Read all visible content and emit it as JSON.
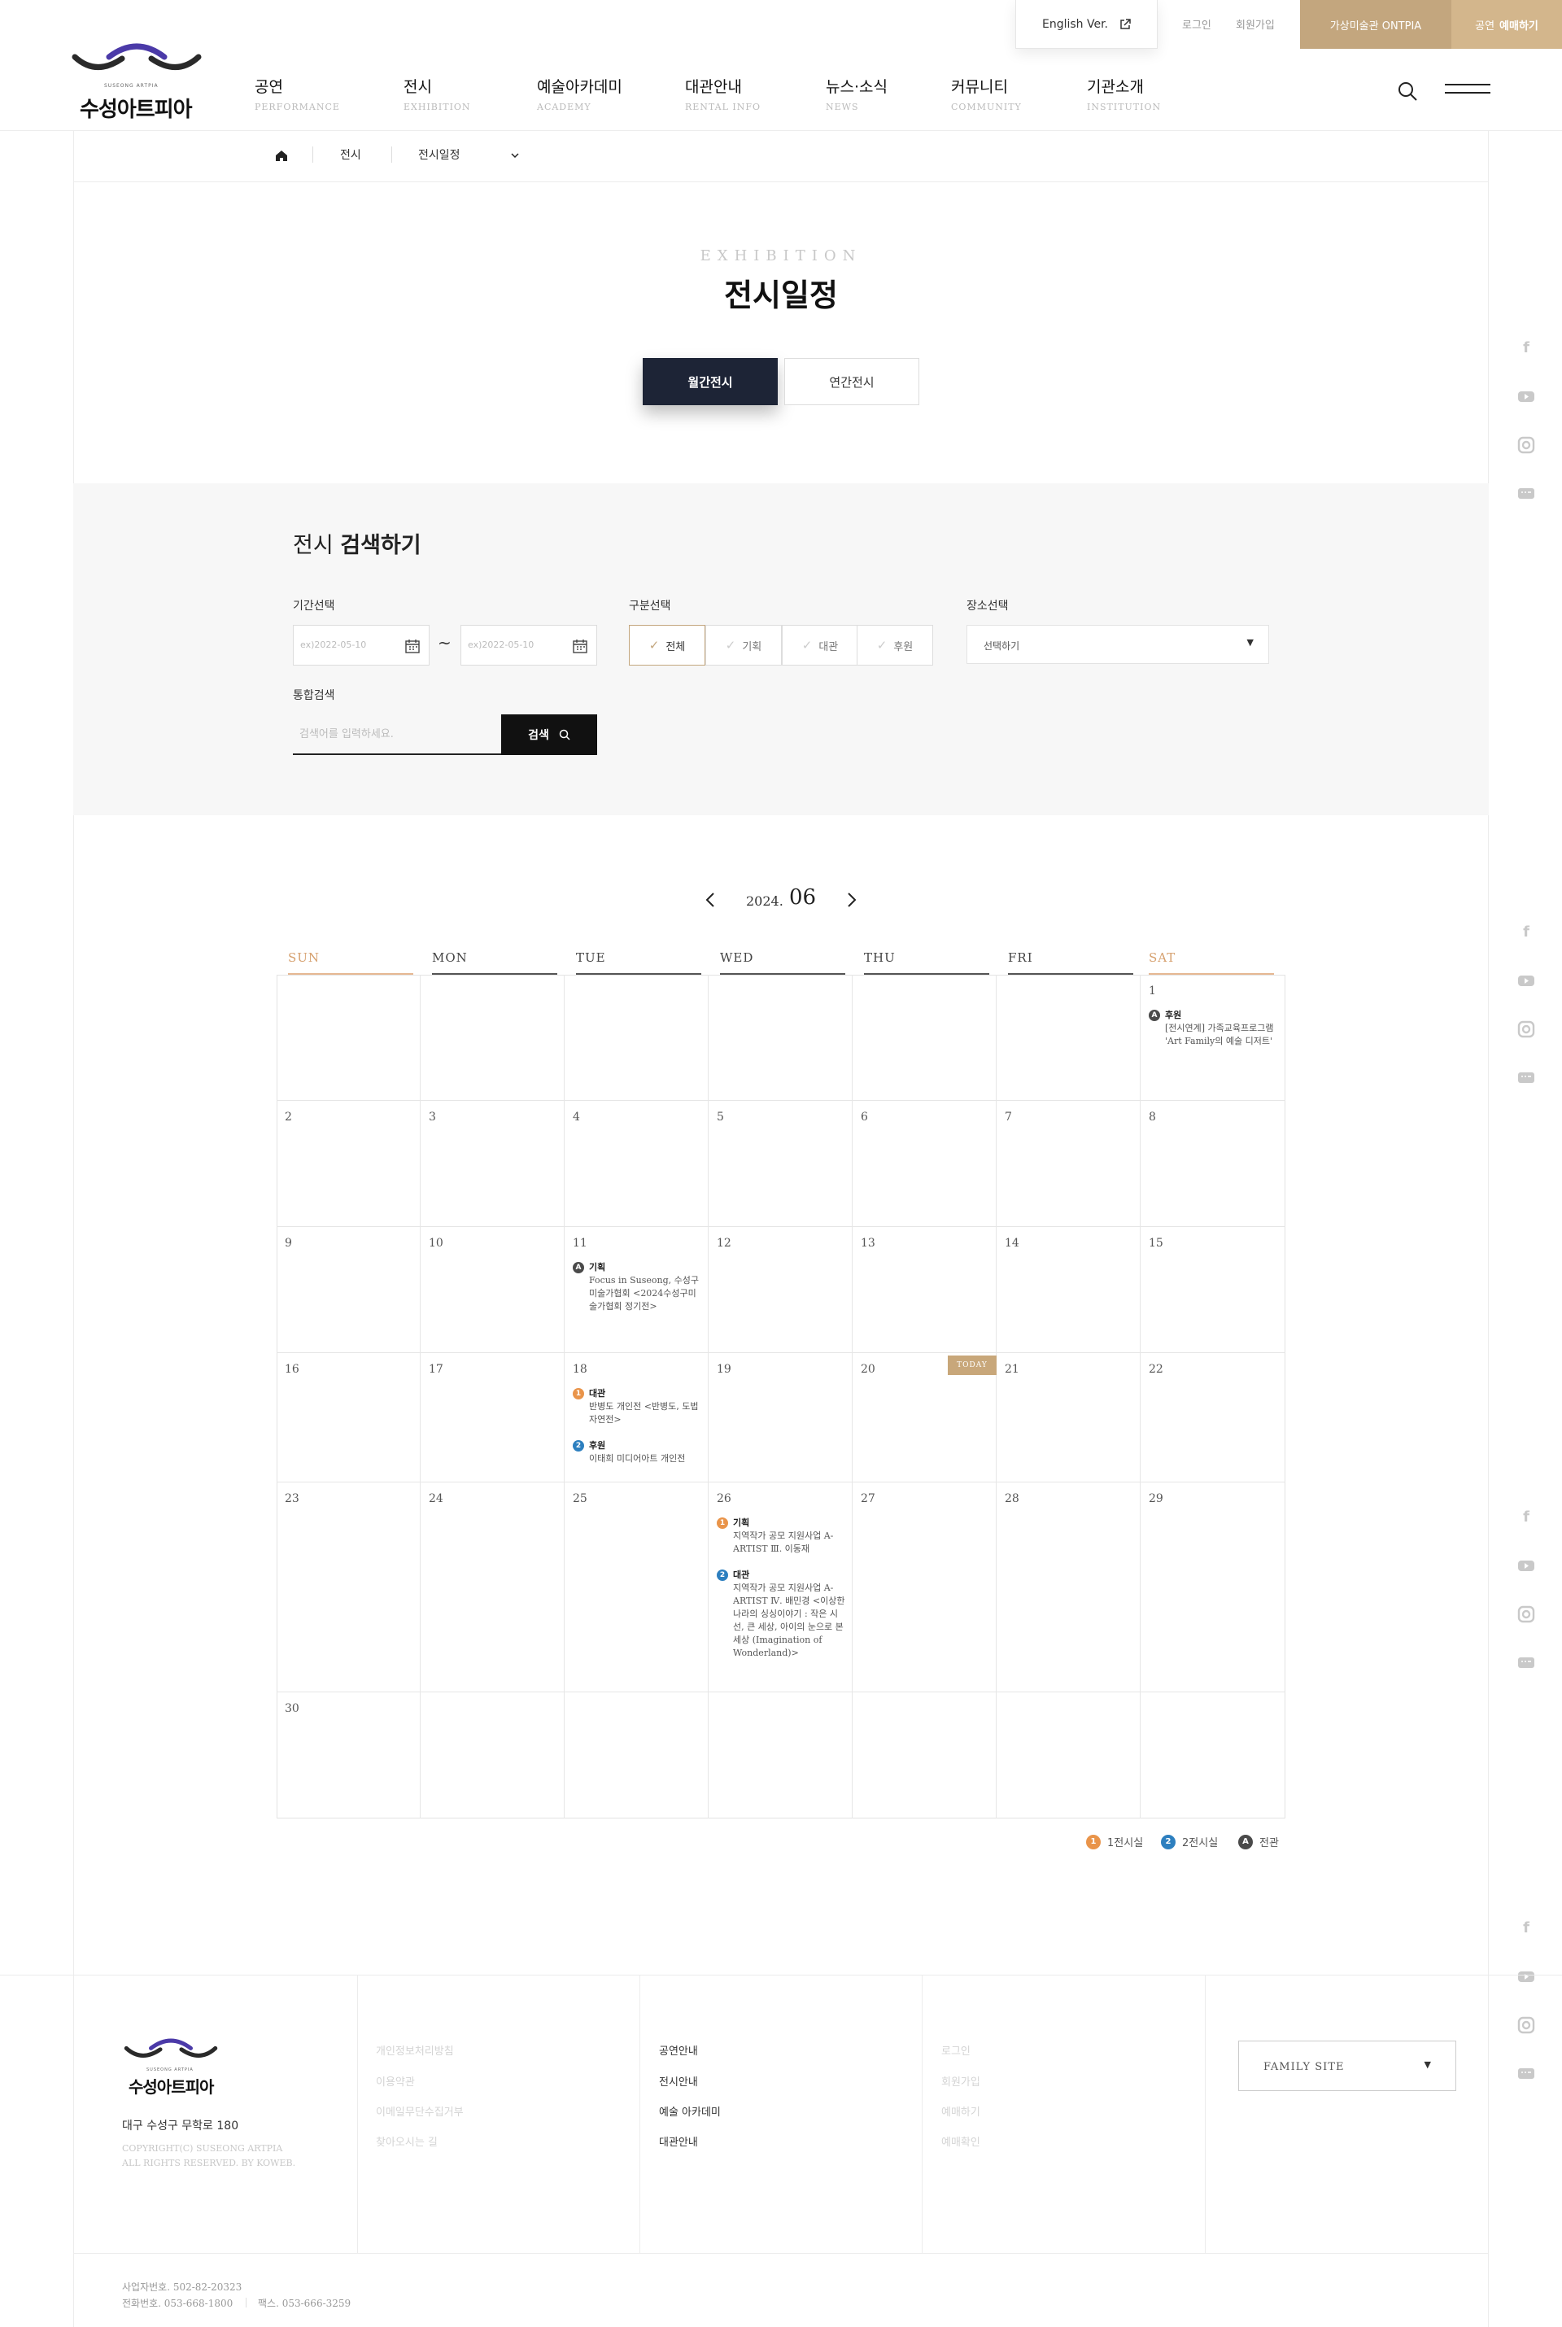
{
  "utility": {
    "english": "English Ver.",
    "login": "로그인",
    "signup": "회원가입",
    "ontpia": "가상미술관 ONTPIA",
    "reserve_prefix": "공연",
    "reserve_bold": "예매하기"
  },
  "logo": {
    "sub": "SUSEONG ARTPIA",
    "text": "수성아트피아"
  },
  "nav": [
    {
      "ko": "공연",
      "en": "PERFORMANCE"
    },
    {
      "ko": "전시",
      "en": "EXHIBITION"
    },
    {
      "ko": "예술아카데미",
      "en": "ACADEMY"
    },
    {
      "ko": "대관안내",
      "en": "RENTAL INFO"
    },
    {
      "ko": "뉴스·소식",
      "en": "NEWS"
    },
    {
      "ko": "커뮤니티",
      "en": "COMMUNITY"
    },
    {
      "ko": "기관소개",
      "en": "INSTITUTION"
    }
  ],
  "breadcrumb": {
    "level1": "전시",
    "level2": "전시일정"
  },
  "title": {
    "en": "EXHIBITION",
    "ko": "전시일정"
  },
  "tabs": {
    "monthly": "월간전시",
    "yearly": "연간전시"
  },
  "search": {
    "title_light": "전시",
    "title_bold": "검색하기",
    "period_label": "기간선택",
    "date_placeholder_from": "ex)2022-05-10",
    "date_placeholder_to": "ex)2022-05-10",
    "tilde": "~",
    "category_label": "구분선택",
    "categories": [
      "전체",
      "기획",
      "대관",
      "후원"
    ],
    "place_label": "장소선택",
    "place_value": "선택하기",
    "keyword_label": "통합검색",
    "keyword_placeholder": "검색어를 입력하세요.",
    "button": "검색"
  },
  "month_nav": {
    "year": "2024.",
    "month": "06"
  },
  "calendar": {
    "weekdays": [
      "SUN",
      "MON",
      "TUE",
      "WED",
      "THU",
      "FRI",
      "SAT"
    ],
    "today_label": "TODAY",
    "days": [
      "1",
      "2",
      "3",
      "4",
      "5",
      "6",
      "7",
      "8",
      "9",
      "10",
      "11",
      "12",
      "13",
      "14",
      "15",
      "16",
      "17",
      "18",
      "19",
      "20",
      "21",
      "22",
      "23",
      "24",
      "25",
      "26",
      "27",
      "28",
      "29",
      "30"
    ],
    "events": {
      "d1": {
        "badge": "A",
        "category": "후원",
        "title": "[전시연계] 가족교육프로그램 'Art Family의 예술 디저트'"
      },
      "d11": {
        "badge": "A",
        "category": "기획",
        "title": "Focus in Suseong, 수성구미술가협회 <2024수성구미술가협회 정기전>"
      },
      "d18a": {
        "badge": "1",
        "category": "대관",
        "title": "반병도 개인전 <반병도, 도법자연전>"
      },
      "d18b": {
        "badge": "2",
        "category": "후원",
        "title": "이태희 미디어아트 개인전"
      },
      "d26a": {
        "badge": "1",
        "category": "기획",
        "title": "지역작가 공모 지원사업 A-ARTIST Ⅲ. 이동재"
      },
      "d26b": {
        "badge": "2",
        "category": "대관",
        "title": "지역작가 공모 지원사업 A-ARTIST Ⅳ. 배민경 <이상한 나라의 싱싱이야기 : 작은 시선, 큰 세상, 아이의 눈으로 본 세상 (Imagination of Wonderland)>"
      }
    }
  },
  "legend": [
    {
      "badge": "1",
      "label": "1전시실"
    },
    {
      "badge": "2",
      "label": "2전시실"
    },
    {
      "badge": "A",
      "label": "전관"
    }
  ],
  "colors": {
    "hall1": "#e9944a",
    "hall2": "#2d7fbf",
    "all": "#4a4a4a",
    "gold": "#c3a67e",
    "navy": "#1d2436"
  },
  "footer": {
    "address": "대구 수성구 무학로 180",
    "copyright_1": "COPYRIGHT(C) SUSEONG ARTPIA",
    "copyright_2": "ALL RIGHTS RESERVED. BY KOWEB.",
    "col1": [
      "개인정보처리방침",
      "이용약관",
      "이메일무단수집거부",
      "찾아오시는 길"
    ],
    "col2": [
      "공연안내",
      "전시안내",
      "예술 아카데미",
      "대관안내"
    ],
    "col3": [
      "로그인",
      "회원가입",
      "예매하기",
      "예매확인"
    ],
    "family_site": "FAMILY SITE",
    "biz_no": "사업자번호. 502-82-20323",
    "tel": "전화번호. 053-668-1800",
    "fax": "팩스. 053-666-3259"
  }
}
